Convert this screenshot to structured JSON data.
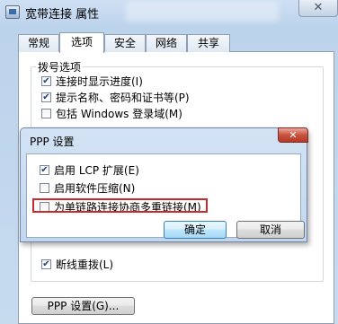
{
  "window": {
    "title": "宽带连接 属性",
    "close_glyph": "✕"
  },
  "tabs": [
    {
      "label": "常规",
      "active": false
    },
    {
      "label": "选项",
      "active": true
    },
    {
      "label": "安全",
      "active": false
    },
    {
      "label": "网络",
      "active": false
    },
    {
      "label": "共享",
      "active": false
    }
  ],
  "dial_options": {
    "group_label": "拨号选项",
    "items": [
      {
        "label": "连接时显示进度(I)",
        "checked": true
      },
      {
        "label": "提示名称、密码和证书等(P)",
        "checked": true
      },
      {
        "label": "包括 Windows 登录域(M)",
        "checked": false
      }
    ]
  },
  "redial": {
    "label": "断线重拨(L)",
    "checked": true
  },
  "ppp_settings_button": "PPP 设置(G)...",
  "ppp_dialog": {
    "title": "PPP 设置",
    "close_glyph": "✕",
    "options": [
      {
        "label": "启用 LCP 扩展(E)",
        "checked": true
      },
      {
        "label": "启用软件压缩(N)",
        "checked": false
      },
      {
        "label": "为单链路连接协商多重链接(M)",
        "checked": false
      }
    ],
    "ok_label": "确定",
    "cancel_label": "取消"
  },
  "colors": {
    "highlight": "#cc2a2a",
    "dialog_close": "#c8523e"
  }
}
